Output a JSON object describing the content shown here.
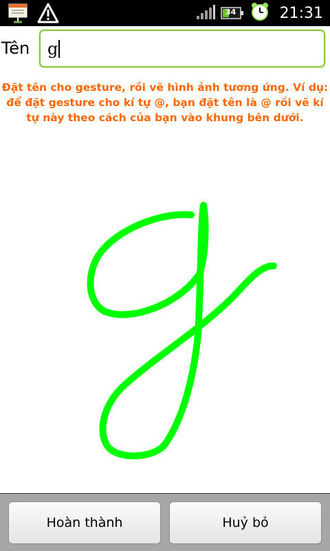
{
  "status_bar": {
    "time": "21:31",
    "battery_level": "34",
    "icons": [
      "notification-icon",
      "warning-icon",
      "signal-icon",
      "battery-icon",
      "alarm-clock-icon"
    ]
  },
  "form": {
    "name_label": "Tên",
    "name_value": "g"
  },
  "hint": "Đặt tên cho gesture, rồi vẽ hình ảnh tương ứng. Ví dụ: để đặt gesture cho kí tự @, bạn đặt tên là @ rồi vẽ kí tự này theo cách của bạn vào khung bên dưới.",
  "gesture": {
    "stroke_color": "#00ff00"
  },
  "buttons": {
    "done_label": "Hoàn thành",
    "cancel_label": "Huỷ bỏ"
  },
  "colors": {
    "hint": "#ff6600",
    "input_border": "#8cc63f"
  }
}
